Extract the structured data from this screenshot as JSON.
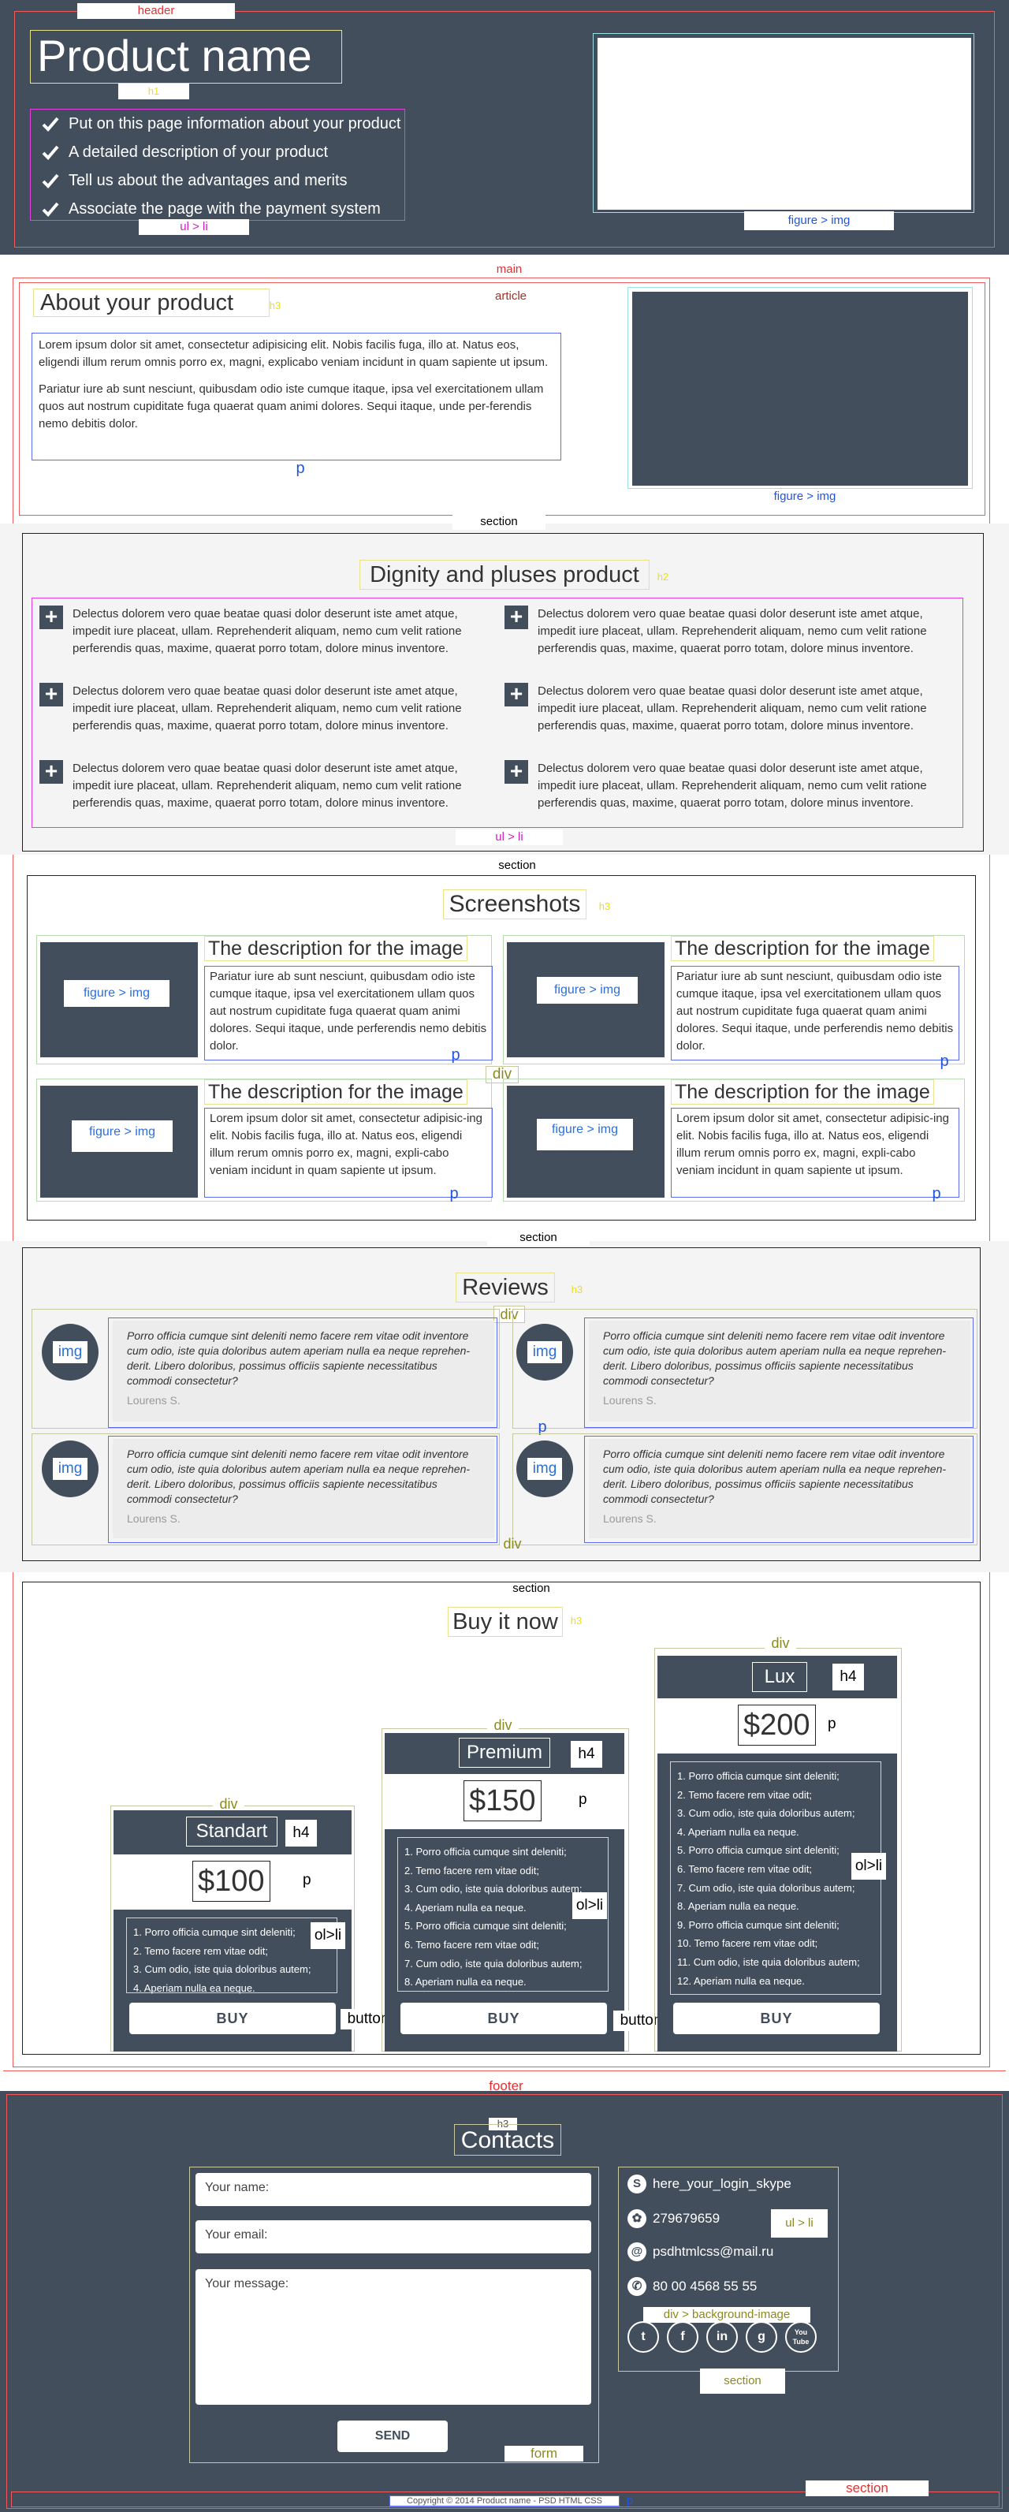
{
  "labels": {
    "header": "header",
    "h1": "h1",
    "ul_li": "ul > li",
    "figure_img": "figure > img",
    "main": "main",
    "article": "article",
    "h3": "h3",
    "p": "p",
    "section": "section",
    "h2": "h2",
    "h4": "h4",
    "div": "div",
    "img": "img",
    "ol_li": "ol>li",
    "button": "button",
    "footer": "footer",
    "form": "form",
    "div_bg_image": "div > background-image"
  },
  "header": {
    "title": "Product name",
    "items": [
      "Put on this page information about your product",
      "A detailed description of your product",
      "Tell us about the advantages and merits",
      "Associate the page with the payment system"
    ]
  },
  "about": {
    "title": "About your product",
    "p1": "Lorem ipsum dolor sit amet, consectetur adipisicing elit. Nobis facilis fuga, illo at. Natus eos, eligendi illum rerum omnis porro ex, magni, explicabo veniam incidunt in quam sapiente ut ipsum.",
    "p2": "Pariatur iure ab sunt nesciunt, quibusdam odio iste cumque itaque, ipsa vel exercitationem ullam quos aut nostrum cupiditate fuga quaerat quam animi dolores. Sequi itaque, unde per-ferendis nemo debitis dolor."
  },
  "dignity": {
    "title": "Dignity and pluses product",
    "text": "Delectus dolorem vero quae beatae quasi dolor deserunt iste amet atque, impedit iure placeat, ullam. Reprehenderit aliquam, nemo cum velit ratione perferendis quas, maxime, quaerat porro totam, dolore minus inventore."
  },
  "screenshots": {
    "title": "Screenshots",
    "item_title": "The description for the image",
    "text_a": "Pariatur iure ab sunt nesciunt, quibusdam odio iste cumque itaque, ipsa vel exercitationem ullam quos aut nostrum cupiditate fuga quaerat quam animi dolores. Sequi itaque, unde perferendis nemo debitis dolor.",
    "text_b": "Lorem ipsum dolor sit amet, consectetur adipisic-ing elit. Nobis facilis fuga, illo at. Natus eos, eligendi illum rerum omnis porro ex, magni, expli-cabo veniam incidunt in quam sapiente ut ipsum."
  },
  "reviews": {
    "title": "Reviews",
    "text": "Porro officia cumque sint deleniti nemo facere rem vitae odit inventore cum odio, iste quia doloribus autem aperiam nulla ea neque reprehen-derit. Libero doloribus, possimus officiis sapiente necessitatibus commodi consectetur?",
    "author": "Lourens S."
  },
  "buy": {
    "title": "Buy it now",
    "button": "BUY",
    "items": [
      "1. Porro officia cumque sint deleniti;",
      "2. Temo facere rem vitae odit;",
      "3. Cum odio, iste quia doloribus autem;",
      "4. Aperiam nulla ea neque.",
      "5. Porro officia cumque sint deleniti;",
      "6. Temo facere rem vitae odit;",
      "7. Cum odio, iste quia doloribus autem;",
      "8. Aperiam nulla ea neque.",
      "9. Porro officia cumque sint deleniti;",
      "10. Temo facere rem vitae odit;",
      "11. Cum odio, iste quia doloribus autem;",
      "12. Aperiam nulla ea neque."
    ],
    "plans": [
      {
        "name": "Standart",
        "price": "$100"
      },
      {
        "name": "Premium",
        "price": "$150"
      },
      {
        "name": "Lux",
        "price": "$200"
      }
    ]
  },
  "contacts": {
    "title": "Contacts",
    "name_ph": "Your name:",
    "email_ph": "Your email:",
    "msg_ph": "Your message:",
    "send": "SEND",
    "skype": "here_your_login_skype",
    "icq": "279679659",
    "email": "psdhtmlcss@mail.ru",
    "phone": "80 00 4568 55 55",
    "social": [
      "t",
      "f",
      "in",
      "g",
      "You Tube"
    ]
  },
  "copyright": "Copyright © 2014 Product name - PSD HTML CSS"
}
